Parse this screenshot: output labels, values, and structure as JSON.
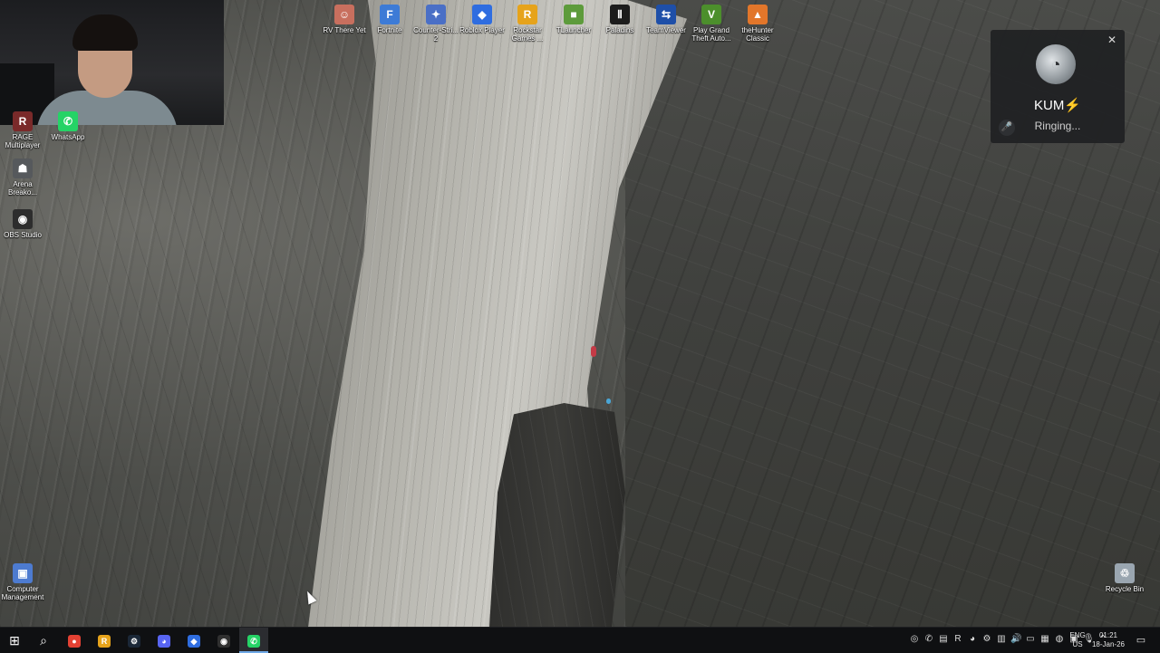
{
  "desktop": {
    "top_icons": [
      {
        "label": "RV There Yet",
        "icon": "rv-there-yet-icon",
        "color": "#c86f5e",
        "glyph": "☺"
      },
      {
        "label": "Fortnite",
        "icon": "fortnite-icon",
        "color": "#3d7bd6",
        "glyph": "F"
      },
      {
        "label": "Counter-Stri... 2",
        "icon": "counter-strike-icon",
        "color": "#4a6fc6",
        "glyph": "✦"
      },
      {
        "label": "Roblox Player",
        "icon": "roblox-icon",
        "color": "#2f6de0",
        "glyph": "◆"
      },
      {
        "label": "Rockstar Games ...",
        "icon": "rockstar-icon",
        "color": "#e6a31b",
        "glyph": "R"
      },
      {
        "label": "TLauncher",
        "icon": "tlauncher-icon",
        "color": "#5d9b3b",
        "glyph": "■"
      },
      {
        "label": "Paladins",
        "icon": "paladins-icon",
        "color": "#1c1c1c",
        "glyph": "Ⅱ"
      },
      {
        "label": "TeamViewer",
        "icon": "teamviewer-icon",
        "color": "#1e4fa8",
        "glyph": "⇆"
      },
      {
        "label": "Play Grand Theft Auto...",
        "icon": "gta-icon",
        "color": "#4c8f2c",
        "glyph": "V"
      },
      {
        "label": "theHunter Classic",
        "icon": "thehunter-icon",
        "color": "#e2762a",
        "glyph": "▲"
      }
    ],
    "left_icons": [
      {
        "label": "RAGE Multiplayer",
        "icon": "rage-mp-icon",
        "color": "#7a2a2a",
        "glyph": "R"
      },
      {
        "label": "WhatsApp",
        "icon": "whatsapp-icon",
        "color": "#25d366",
        "glyph": "✆"
      },
      {
        "label": "Arena Breako...",
        "icon": "arena-breakout-icon",
        "color": "#56595c",
        "glyph": "☗"
      },
      {
        "label": "OBS Studio",
        "icon": "obs-studio-icon",
        "color": "#2d2d2d",
        "glyph": "◉"
      }
    ],
    "bottom_icons": [
      {
        "label": "Computer Management",
        "icon": "computer-management-icon",
        "color": "#4d7bd0",
        "glyph": "▣"
      },
      {
        "label": "Recycle Bin",
        "icon": "recycle-bin-icon",
        "color": "#9aa6b0",
        "glyph": "♲"
      }
    ]
  },
  "call": {
    "name": "KUM⚡",
    "status": "Ringing...",
    "close_glyph": "✕",
    "mic_glyph": "🎤",
    "avatar_glyph": "◔"
  },
  "taskbar": {
    "start_glyph": "⊞",
    "search_glyph": "⌕",
    "apps": [
      {
        "name": "chrome-icon",
        "color": "#e34133",
        "glyph": "●"
      },
      {
        "name": "rockstar-launcher-icon",
        "color": "#e6a31b",
        "glyph": "R"
      },
      {
        "name": "steam-icon",
        "color": "#1b2838",
        "glyph": "⚙"
      },
      {
        "name": "discord-icon",
        "color": "#5865f2",
        "glyph": "◕"
      },
      {
        "name": "roblox-taskbar-icon",
        "color": "#2f6de0",
        "glyph": "◆"
      },
      {
        "name": "obs-taskbar-icon",
        "color": "#303030",
        "glyph": "◉"
      },
      {
        "name": "whatsapp-taskbar-icon",
        "color": "#25d366",
        "glyph": "✆"
      }
    ],
    "tray": [
      {
        "name": "tray-app-1-icon",
        "glyph": "◎"
      },
      {
        "name": "tray-whatsapp-icon",
        "glyph": "✆"
      },
      {
        "name": "tray-app-3-icon",
        "glyph": "▤"
      },
      {
        "name": "tray-rockstar-icon",
        "glyph": "R"
      },
      {
        "name": "tray-discord-icon",
        "glyph": "◕"
      },
      {
        "name": "tray-steam-icon",
        "glyph": "⚙"
      },
      {
        "name": "tray-network-icon",
        "glyph": "▥"
      },
      {
        "name": "tray-volume-icon",
        "glyph": "🔊"
      },
      {
        "name": "tray-display-icon",
        "glyph": "▭"
      },
      {
        "name": "tray-app-10-icon",
        "glyph": "▦"
      },
      {
        "name": "tray-app-11-icon",
        "glyph": "◍"
      },
      {
        "name": "tray-app-12-icon",
        "glyph": "▣"
      },
      {
        "name": "tray-mic-icon",
        "glyph": "🎙"
      },
      {
        "name": "tray-overflow-icon",
        "glyph": "⌃"
      }
    ],
    "language": {
      "line1": "ENG",
      "line2": "US"
    },
    "clock": {
      "time": "01:21",
      "date": "18-Jan-26"
    },
    "notification_glyph": "▭"
  }
}
